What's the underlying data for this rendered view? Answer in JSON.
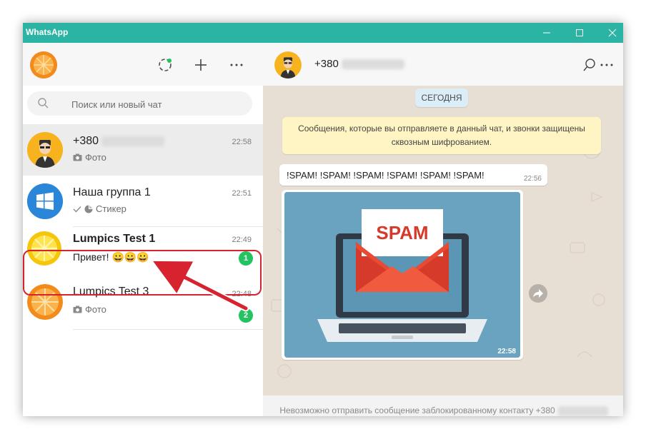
{
  "window": {
    "title": "WhatsApp",
    "controls": [
      "minimize",
      "maximize",
      "close"
    ]
  },
  "sidebar": {
    "search_placeholder": "Поиск или новый чат",
    "chats": [
      {
        "name": "+380",
        "time": "22:58",
        "preview_icon": "camera-icon",
        "preview": "Фото",
        "unread": null,
        "active": true
      },
      {
        "name": "Наша группа 1",
        "time": "22:51",
        "preview_icon": "sticker-icon",
        "preview": "Стикер",
        "unread": null,
        "active": false
      },
      {
        "name": "Lumpics Test 1",
        "time": "22:49",
        "preview_icon": null,
        "preview": "Привет! 😀😀😀",
        "unread": "1",
        "active": false
      },
      {
        "name": "Lumpics Test 3",
        "time": "22:48",
        "preview_icon": "camera-icon",
        "preview": "Фото",
        "unread": "2",
        "active": false
      }
    ]
  },
  "conversation": {
    "contact": "+380",
    "date_label": "СЕГОДНЯ",
    "encryption_notice": "Сообщения, которые вы отправляете в данный чат, и звонки защищены сквозным шифрованием.",
    "messages": [
      {
        "type": "text",
        "text": "!SPAM! !SPAM! !SPAM! !SPAM! !SPAM! !SPAM!",
        "time": "22:56"
      },
      {
        "type": "image",
        "image_text": "SPAM",
        "time": "22:58"
      }
    ],
    "footer_text": "Невозможно отправить сообщение заблокированному контакту +380"
  },
  "colors": {
    "titlebar": "#2bb4a3",
    "badge": "#25c262",
    "annotation": "#d7232f"
  }
}
